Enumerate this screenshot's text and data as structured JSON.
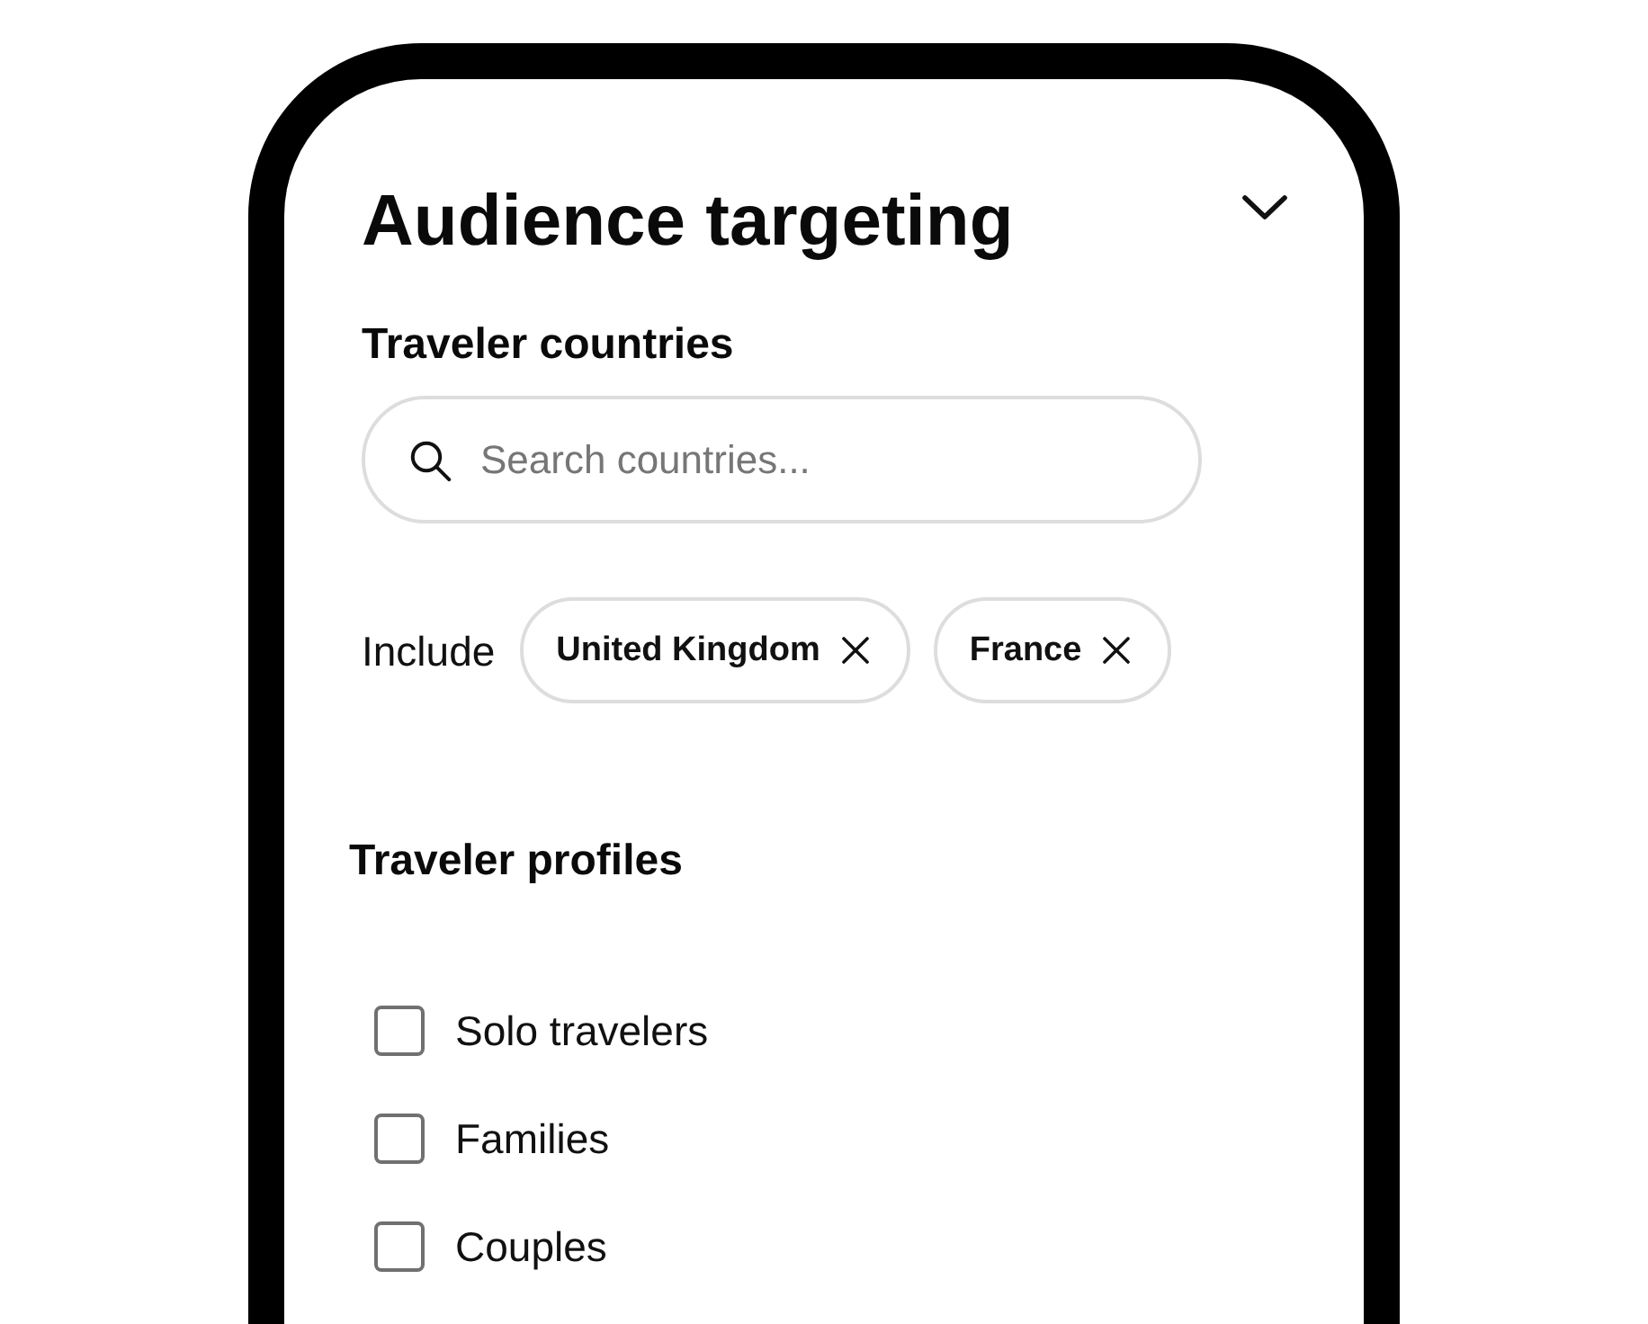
{
  "panel": {
    "title": "Audience targeting"
  },
  "countries": {
    "heading": "Traveler countries",
    "search": {
      "placeholder": "Search countries..."
    },
    "include_label": "Include",
    "chips": [
      {
        "label": "United Kingdom"
      },
      {
        "label": "France"
      }
    ]
  },
  "profiles": {
    "heading": "Traveler profiles",
    "options": [
      {
        "label": "Solo travelers",
        "checked": false
      },
      {
        "label": "Families",
        "checked": false
      },
      {
        "label": "Couples",
        "checked": false
      }
    ]
  }
}
